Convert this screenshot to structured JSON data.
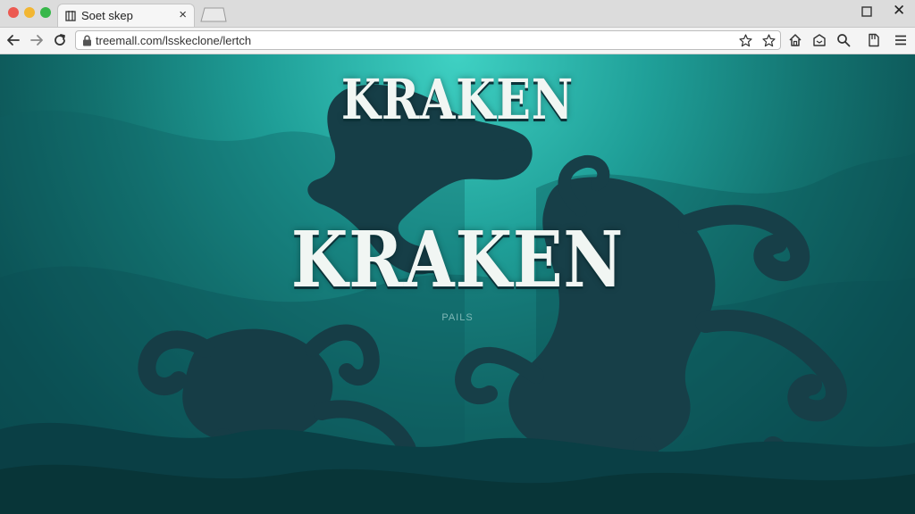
{
  "browser": {
    "tab_title": "Soet skep",
    "tab_close": "×",
    "url": "treemall.com/lsskeclone/lertch",
    "window_close": "✕"
  },
  "page": {
    "title_top": "KRAKEN",
    "title_main": "KRAKEN",
    "subtitle": "PAILS"
  },
  "colors": {
    "sea_light": "#3fd1c3",
    "sea_dark": "#083a3e",
    "silhouette": "#163e47",
    "title_text": "#f1f6f3"
  }
}
